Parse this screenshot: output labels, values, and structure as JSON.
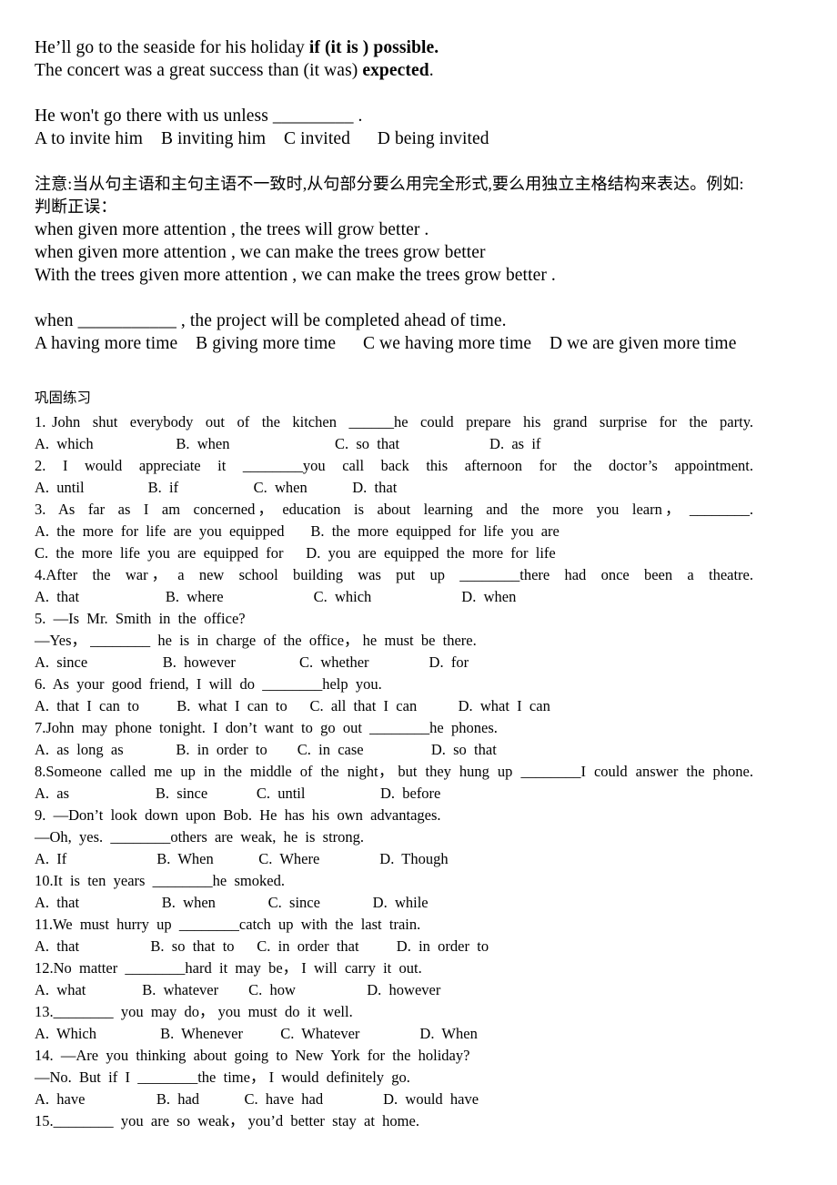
{
  "notes": {
    "lines": [
      {
        "id": "note-line-1",
        "pre": "He’ll go to the seaside for his holiday ",
        "bold": "if (it is ) possible.",
        "post": ""
      },
      {
        "id": "note-line-2",
        "pre": "The concert was a great success than (it was) ",
        "bold": "expected",
        "post": "."
      },
      {
        "id": "note-line-3",
        "text": ""
      },
      {
        "id": "note-line-4",
        "text": "He won't go there with us unless _________ ."
      },
      {
        "id": "note-line-5",
        "text": "A to invite him    B inviting him    C invited      D being invited"
      },
      {
        "id": "note-line-6",
        "text": ""
      },
      {
        "id": "note-line-7",
        "cn": true,
        "text": "注意:当从句主语和主句主语不一致时,从句部分要么用完全形式,要么用独立主格结构来表达。例如:"
      },
      {
        "id": "note-line-8",
        "cn": true,
        "text": "判断正误："
      },
      {
        "id": "note-line-9",
        "text": "when given more attention , the trees will grow better ."
      },
      {
        "id": "note-line-10",
        "text": "when given more attention , we can make the trees grow better"
      },
      {
        "id": "note-line-11",
        "text": "With the trees given more attention , we can make the trees grow better ."
      },
      {
        "id": "note-line-12",
        "text": ""
      },
      {
        "id": "note-line-13",
        "text": "when ___________ , the project will be completed ahead of time."
      },
      {
        "id": "note-line-14",
        "text": "A having more time    B giving more time      C we having more time    D we are given more time"
      }
    ]
  },
  "drill_heading": "巩固练习",
  "drills": [
    {
      "id": "q1",
      "stem": "1. John  shut  everybody  out  of  the  kitchen  ______he  could  prepare  his  grand  surprise  for  the  party.",
      "options": "A.  which                      B.  when                            C.  so  that                        D.  as  if"
    },
    {
      "id": "q2",
      "stem": "2.  I  would  appreciate  it  ________you  call  back  this  afternoon  for  the  doctor’s  appointment.",
      "options": "A.  until                 B.  if                    C.  when            D.  that"
    },
    {
      "id": "q3",
      "stem": "3.  As  far  as  I  am  concerned， education  is  about  learning  and  the  more  you  learn， ________.",
      "options": "A.  the  more  for  life  are  you  equipped       B.  the  more  equipped  for  life  you  are",
      "options2": "C.  the  more  life  you  are  equipped  for      D.  you  are  equipped  the  more  for  life"
    },
    {
      "id": "q4",
      "stem": "4.After  the  war， a  new  school  building  was  put  up  ________there  had  once  been  a  theatre.",
      "options": "A.  that                       B.  where                        C.  which                        D.  when"
    },
    {
      "id": "q5",
      "stem": "5.  —Is  Mr.  Smith  in  the  office?",
      "stem2": "—Yes， ________  he  is  in  charge  of  the  office， he  must  be  there.",
      "options": "A.  since                    B.  however                 C.  whether                D.  for"
    },
    {
      "id": "q6",
      "stem": "6.  As  your  good  friend,  I  will  do  ________help  you.",
      "options": "A.  that  I  can  to          B.  what  I  can  to      C.  all  that  I  can           D.  what  I  can"
    },
    {
      "id": "q7",
      "stem": "7.John  may  phone  tonight.  I  don’t  want  to  go  out  ________he  phones.",
      "options": "A.  as  long  as              B.  in  order  to        C.  in  case                  D.  so  that"
    },
    {
      "id": "q8",
      "stem": "8.Someone  called  me  up  in  the  middle  of  the  night， but  they  hung  up  ________I  could  answer  the  phone.",
      "options": "A.  as                       B.  since             C.  until                    D.  before"
    },
    {
      "id": "q9",
      "stem": "9.  —Don’t  look  down  upon  Bob.  He  has  his  own  advantages.",
      "stem2": "—Oh,  yes.  ________others  are  weak,  he  is  strong.",
      "options": "A.  If                        B.  When            C.  Where                D.  Though"
    },
    {
      "id": "q10",
      "stem": "10.It  is  ten  years  ________he  smoked.",
      "options": "A.  that                      B.  when              C.  since              D.  while"
    },
    {
      "id": "q11",
      "stem": "11.We  must  hurry  up  ________catch  up  with  the  last  train.",
      "options": "A.  that                   B.  so  that  to      C.  in  order  that          D.  in  order  to"
    },
    {
      "id": "q12",
      "stem": "12.No  matter  ________hard  it  may  be， I  will  carry  it  out.",
      "options": "A.  what               B.  whatever        C.  how                   D.  however"
    },
    {
      "id": "q13",
      "stem": "13.________  you  may  do， you  must  do  it  well.",
      "options": "A.  Which                 B.  Whenever          C.  Whatever                D.  When"
    },
    {
      "id": "q14",
      "stem": "14.  —Are  you  thinking  about  going  to  New  York  for  the  holiday?",
      "stem2": "—No.  But  if  I  ________the  time， I  would  definitely  go.",
      "options": "A.  have                   B.  had            C.  have  had                D.  would  have"
    },
    {
      "id": "q15",
      "stem": "15.________  you  are  so  weak， you’d  better  stay  at  home.",
      "options": ""
    }
  ]
}
